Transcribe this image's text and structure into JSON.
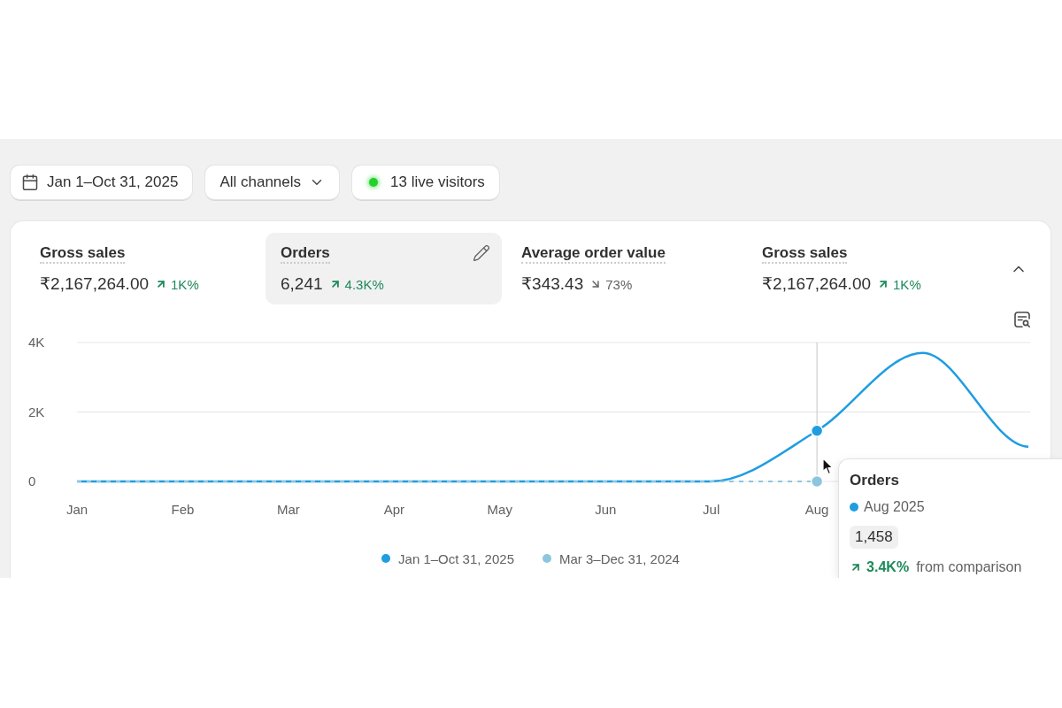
{
  "filters": [
    {
      "kind": "date",
      "label": "Jan 1–Oct 31, 2025"
    },
    {
      "kind": "dropdown",
      "label": "All channels"
    },
    {
      "kind": "live",
      "label": "13 live visitors"
    }
  ],
  "card": {
    "expanded": true,
    "metrics": [
      {
        "label": "Gross sales",
        "value": "₹2,167,264.00",
        "change": "1K%",
        "increase": true,
        "selected": false
      },
      {
        "label": "Orders",
        "value": "6,241",
        "change": "4.3K%",
        "increase": true,
        "selected": true
      },
      {
        "label": "Average order value",
        "value": "₹343.43",
        "change": "73%",
        "increase": false,
        "selected": false
      },
      {
        "label": "Gross sales",
        "value": "₹2,167,264.00",
        "change": "1K%",
        "increase": true,
        "selected": false
      }
    ],
    "chart": {
      "chart_data": {
        "type": "line",
        "categories": [
          "Jan",
          "Feb",
          "Mar",
          "Apr",
          "May",
          "Jun",
          "Jul",
          "Aug",
          null,
          null
        ],
        "ylim": [
          0,
          4000
        ],
        "yticks": [
          {
            "value": 0,
            "label": "0"
          },
          {
            "value": 2000,
            "label": "2K"
          },
          {
            "value": 4000,
            "label": "4K"
          }
        ],
        "series": [
          {
            "name": "Jan 1–Oct 31, 2025",
            "color": "#1f9de0",
            "line_style": "solid",
            "values": [
              0,
              0,
              0,
              0,
              0,
              0,
              0,
              1458,
              3700,
              1000
            ]
          },
          {
            "name": "Mar 3–Dec 31, 2024",
            "color": "#8cc6de",
            "line_style": "dashed",
            "values": [
              0,
              0,
              0,
              0,
              0,
              0,
              0,
              0,
              null,
              null
            ]
          }
        ],
        "ref_lines": [
          {
            "axis": "x",
            "value": "Aug"
          }
        ]
      },
      "tooltip": {
        "title": "Orders",
        "period": "Aug 2025",
        "value": "1,458",
        "change": "3.4K%",
        "increase": true,
        "note": "from comparison"
      }
    }
  }
}
